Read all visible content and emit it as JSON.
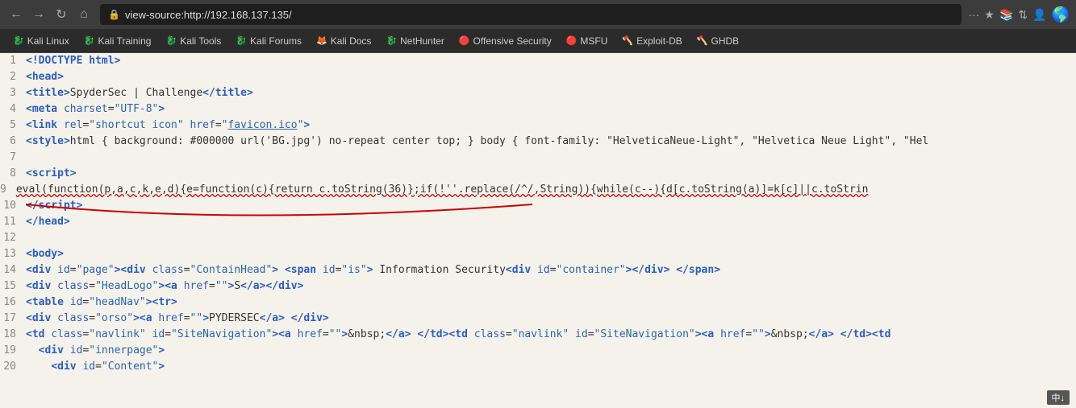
{
  "browser": {
    "url": "view-source:http://192.168.137.135/",
    "back_label": "←",
    "forward_label": "→",
    "reload_label": "↻",
    "home_label": "⌂",
    "more_label": "···",
    "bookmark_label": "☆",
    "history_label": "📚"
  },
  "bookmarks": [
    {
      "id": "kali-linux",
      "icon": "🐉",
      "label": "Kali Linux",
      "color": "bk-kali"
    },
    {
      "id": "kali-training",
      "icon": "🐉",
      "label": "Kali Training",
      "color": "bk-kali-training"
    },
    {
      "id": "kali-tools",
      "icon": "🐉",
      "label": "Kali Tools",
      "color": "bk-kali-tools"
    },
    {
      "id": "kali-forums",
      "icon": "🐉",
      "label": "Kali Forums",
      "color": "bk-kali-forums"
    },
    {
      "id": "kali-docs",
      "icon": "🦊",
      "label": "Kali Docs",
      "color": "bk-kali-docs"
    },
    {
      "id": "nethunter",
      "icon": "🐉",
      "label": "NetHunter",
      "color": "bk-nethunter"
    },
    {
      "id": "offensive-security",
      "icon": "🔴",
      "label": "Offensive Security",
      "color": "bk-offensive"
    },
    {
      "id": "msfu",
      "icon": "🔴",
      "label": "MSFU",
      "color": "bk-msfu"
    },
    {
      "id": "exploit-db",
      "icon": "🪓",
      "label": "Exploit-DB",
      "color": "bk-exploit"
    },
    {
      "id": "ghdb",
      "icon": "🪓",
      "label": "GHDB",
      "color": "bk-ghdb"
    }
  ],
  "source_lines": [
    {
      "num": 1,
      "html": "<span class='tag'>&lt;!DOCTYPE html&gt;</span>"
    },
    {
      "num": 2,
      "html": "<span class='tag'>&lt;head&gt;</span>"
    },
    {
      "num": 3,
      "html": "<span class='tag'>&lt;title&gt;</span>SpyderSec | Challenge<span class='tag'>&lt;/title&gt;</span>"
    },
    {
      "num": 4,
      "html": "<span class='tag'>&lt;meta</span> <span class='attr-name'>charset</span>=<span class='attr-value'>\"UTF-8\"</span><span class='tag'>&gt;</span>"
    },
    {
      "num": 5,
      "html": "<span class='tag'>&lt;link</span> <span class='attr-name'>rel</span>=<span class='attr-value'>\"shortcut icon\"</span> <span class='attr-name'>href</span>=<span class='attr-value'>\"<a href='#'>favicon.ico</a>\"</span><span class='tag'>&gt;</span>"
    },
    {
      "num": 6,
      "html": "<span class='tag'>&lt;style&gt;</span>html { background: #000000 url('BG.jpg') no-repeat center top; } body { font-family: \"HelveticaNeue-Light\", \"Helvetica Neue Light\", \"Hel"
    },
    {
      "num": 7,
      "html": ""
    },
    {
      "num": 8,
      "html": "<span class='tag'>&lt;script&gt;</span>"
    },
    {
      "num": 9,
      "html": "eval(function(p,a,c,k,e,d){e=function(c){return c.toString(36)};if(!''.replace(/^/,String)){while(c--){d[c.toString(a)]=k[c]||c.toStrin"
    },
    {
      "num": 10,
      "html": "<span class='tag'>&lt;/script&gt;</span>"
    },
    {
      "num": 11,
      "html": "<span class='tag'>&lt;/head&gt;</span>"
    },
    {
      "num": 12,
      "html": ""
    },
    {
      "num": 13,
      "html": "<span class='tag'>&lt;body&gt;</span>"
    },
    {
      "num": 14,
      "html": "<span class='tag'>&lt;div</span> <span class='attr-name'>id</span>=<span class='attr-value'>\"page\"</span><span class='tag'>&gt;</span><span class='tag'>&lt;div</span> <span class='attr-name'>class</span>=<span class='attr-value'>\"ContainHead\"</span><span class='tag'>&gt;</span> <span class='tag'>&lt;span</span> <span class='attr-name'>id</span>=<span class='attr-value'>\"is\"</span><span class='tag'>&gt;</span> Information Security<span class='tag'>&lt;div</span> <span class='attr-name'>id</span>=<span class='attr-value'>\"container\"</span><span class='tag'>&gt;&lt;/div&gt;</span> <span class='tag'>&lt;/span&gt;</span>"
    },
    {
      "num": 15,
      "html": "<span class='tag'>&lt;div</span> <span class='attr-name'>class</span>=<span class='attr-value'>\"HeadLogo\"</span><span class='tag'>&gt;</span><span class='tag'>&lt;a</span> <span class='attr-name'>href</span>=<span class='attr-value'>\"\"</span><span class='tag'>&gt;</span>S<span class='tag'>&lt;/a&gt;&lt;/div&gt;</span>"
    },
    {
      "num": 16,
      "html": "<span class='tag'>&lt;table</span> <span class='attr-name'>id</span>=<span class='attr-value'>\"headNav\"</span><span class='tag'>&gt;&lt;tr&gt;</span>"
    },
    {
      "num": 17,
      "html": "<span class='tag'>&lt;div</span> <span class='attr-name'>class</span>=<span class='attr-value'>\"orso\"</span><span class='tag'>&gt;</span><span class='tag'>&lt;a</span> <span class='attr-name'>href</span>=<span class='attr-value'>\"\"</span><span class='tag'>&gt;</span>PYDERSEC<span class='tag'>&lt;/a&gt;</span> <span class='tag'>&lt;/div&gt;</span>"
    },
    {
      "num": 18,
      "html": "<span class='tag'>&lt;td</span> <span class='attr-name'>class</span>=<span class='attr-value'>\"navlink\"</span> <span class='attr-name'>id</span>=<span class='attr-value'>\"SiteNavigation\"</span><span class='tag'>&gt;</span><span class='tag'>&lt;a</span> <span class='attr-name'>href</span>=<span class='attr-value'>\"\"</span><span class='tag'>&gt;</span>&amp;nbsp;<span class='tag'>&lt;/a&gt;</span> <span class='tag'>&lt;/td&gt;</span><span class='tag'>&lt;td</span> <span class='attr-name'>class</span>=<span class='attr-value'>\"navlink\"</span> <span class='attr-name'>id</span>=<span class='attr-value'>\"SiteNavigation\"</span><span class='tag'>&gt;</span><span class='tag'>&lt;a</span> <span class='attr-name'>href</span>=<span class='attr-value'>\"\"</span><span class='tag'>&gt;</span>&amp;nbsp;<span class='tag'>&lt;/a&gt;</span> <span class='tag'>&lt;/td&gt;&lt;td</span>"
    },
    {
      "num": 19,
      "html": "  <span class='tag'>&lt;div</span> <span class='attr-name'>id</span>=<span class='attr-value'>\"innerpage\"</span><span class='tag'>&gt;</span>"
    },
    {
      "num": 20,
      "html": "    <span class='tag'>&lt;div</span> <span class='attr-name'>id</span>=<span class='attr-value'>\"Content\"</span><span class='tag'>&gt;</span>"
    }
  ],
  "bottom_indicator": "中↓",
  "annotation": {
    "line": 9,
    "note": "red arc drawn under eval line"
  }
}
